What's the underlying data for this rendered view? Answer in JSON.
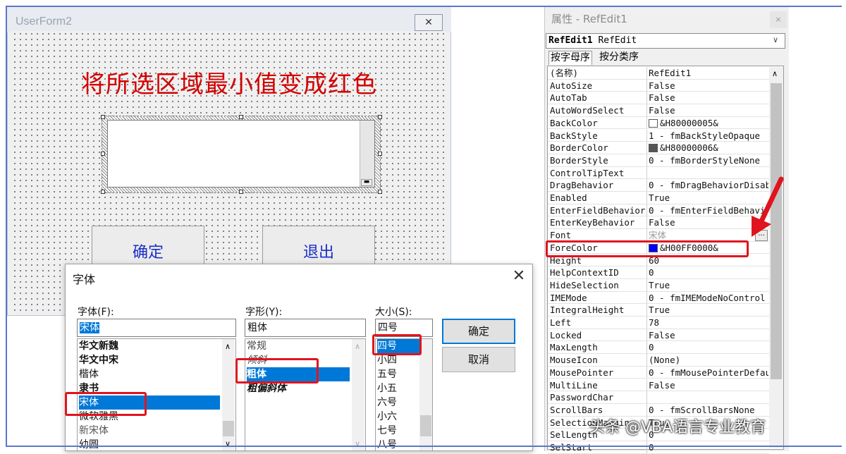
{
  "userform": {
    "title": "UserForm2",
    "close_glyph": "✕",
    "heading": "将所选区域最小值变成红色",
    "ok_button": "确定",
    "exit_button": "退出"
  },
  "font_dialog": {
    "title": "字体",
    "close_glyph": "✕",
    "font_label": "字体(F):",
    "font_value": "宋体",
    "font_list": [
      "华文新魏",
      "华文中宋",
      "楷体",
      "隶书",
      "宋体",
      "微软雅黑",
      "新宋体",
      "幼圆"
    ],
    "font_selected": "宋体",
    "style_label": "字形(Y):",
    "style_value": "粗体",
    "style_list": [
      "常规",
      "倾斜",
      "粗体",
      "粗偏斜体"
    ],
    "style_selected": "粗体",
    "size_label": "大小(S):",
    "size_value": "四号",
    "size_list": [
      "四号",
      "小四",
      "五号",
      "小五",
      "六号",
      "小六",
      "七号",
      "八号"
    ],
    "size_selected": "四号",
    "ok_button": "确定",
    "cancel_button": "取消"
  },
  "properties": {
    "title": "属性 - RefEdit1",
    "close_glyph": "×",
    "object_name": "RefEdit1",
    "object_type": "RefEdit",
    "tabs": [
      "按字母序",
      "按分类序"
    ],
    "rows": [
      {
        "name": "(名称)",
        "value": "RefEdit1"
      },
      {
        "name": "AutoSize",
        "value": "False"
      },
      {
        "name": "AutoTab",
        "value": "False"
      },
      {
        "name": "AutoWordSelect",
        "value": "False"
      },
      {
        "name": "BackColor",
        "value": "&H80000005&",
        "swatch": "#ffffff"
      },
      {
        "name": "BackStyle",
        "value": "1 - fmBackStyleOpaque"
      },
      {
        "name": "BorderColor",
        "value": "&H80000006&",
        "swatch": "#555555"
      },
      {
        "name": "BorderStyle",
        "value": "0 - fmBorderStyleNone"
      },
      {
        "name": "ControlTipText",
        "value": ""
      },
      {
        "name": "DragBehavior",
        "value": "0 - fmDragBehaviorDisab"
      },
      {
        "name": "Enabled",
        "value": "True"
      },
      {
        "name": "EnterFieldBehavior",
        "value": "0 - fmEnterFieldBehavi"
      },
      {
        "name": "EnterKeyBehavior",
        "value": "False"
      },
      {
        "name": "Font",
        "value": "宋体"
      },
      {
        "name": "ForeColor",
        "value": "&H00FF0000&",
        "swatch": "#0000ff"
      },
      {
        "name": "Height",
        "value": "60"
      },
      {
        "name": "HelpContextID",
        "value": "0"
      },
      {
        "name": "HideSelection",
        "value": "True"
      },
      {
        "name": "IMEMode",
        "value": "0 - fmIMEModeNoControl"
      },
      {
        "name": "IntegralHeight",
        "value": "True"
      },
      {
        "name": "Left",
        "value": "78"
      },
      {
        "name": "Locked",
        "value": "False"
      },
      {
        "name": "MaxLength",
        "value": "0"
      },
      {
        "name": "MouseIcon",
        "value": "(None)"
      },
      {
        "name": "MousePointer",
        "value": "0 - fmMousePointerDefau"
      },
      {
        "name": "MultiLine",
        "value": "False"
      },
      {
        "name": "PasswordChar",
        "value": ""
      },
      {
        "name": "ScrollBars",
        "value": "0 - fmScrollBarsNone"
      },
      {
        "name": "SelectionMargin",
        "value": "True"
      },
      {
        "name": "SelLength",
        "value": "0"
      },
      {
        "name": "SelStart",
        "value": "0"
      }
    ]
  },
  "watermark": "头条 @VBA语言专业教育",
  "colors": {
    "heading": "#d40000",
    "button_text": "#1a2ec8",
    "highlight": "#e0141e",
    "selection": "#0078d7"
  }
}
